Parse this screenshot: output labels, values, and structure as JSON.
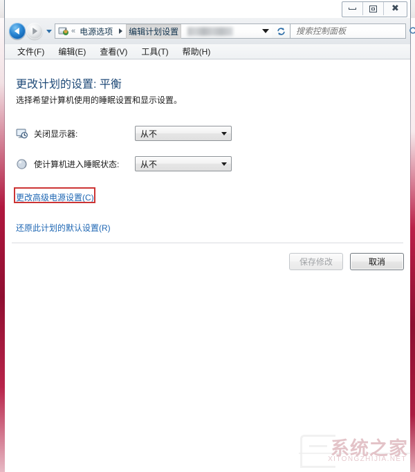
{
  "window": {
    "controls": {
      "minimize_label": "最小化",
      "maximize_label": "最大化",
      "close_label": "关闭"
    }
  },
  "navbar": {
    "back_label": "后退",
    "forward_label": "前进",
    "history_label": "最近浏览的位置",
    "breadcrumb": {
      "separator": "«",
      "items": [
        {
          "label": "电源选项",
          "selected": false
        },
        {
          "label": "编辑计划设置",
          "selected": true
        }
      ],
      "redacted_label": ""
    },
    "refresh_label": "刷新",
    "search": {
      "value": "",
      "placeholder": "搜索控制面板"
    }
  },
  "menubar": {
    "items": [
      {
        "label": "文件(F)"
      },
      {
        "label": "编辑(E)"
      },
      {
        "label": "查看(V)"
      },
      {
        "label": "工具(T)"
      },
      {
        "label": "帮助(H)"
      }
    ]
  },
  "content": {
    "title": "更改计划的设置: 平衡",
    "subtitle": "选择希望计算机使用的睡眠设置和显示设置。",
    "settings": [
      {
        "icon": "monitor-clock-icon",
        "label": "关闭显示器:",
        "value": "从不"
      },
      {
        "icon": "moon-sleep-icon",
        "label": "使计算机进入睡眠状态:",
        "value": "从不"
      }
    ],
    "links": [
      {
        "label": "更改高级电源设置(C)",
        "highlighted": true
      },
      {
        "label": "还原此计划的默认设置(R)",
        "highlighted": false
      }
    ],
    "buttons": {
      "save_label": "保存修改",
      "save_enabled": false,
      "cancel_label": "取消",
      "cancel_enabled": true
    }
  },
  "watermark": {
    "cn": "系统之家",
    "en": "XITONGZHIJIA.NET"
  },
  "colors": {
    "title_blue": "#1f4a78",
    "link_blue": "#1d66b3",
    "highlight_red": "#cc3333",
    "edge_red": "#a81a3f"
  }
}
